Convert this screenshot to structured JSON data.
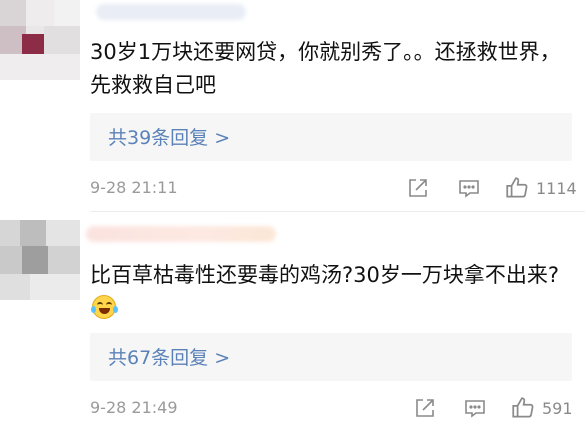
{
  "comments": [
    {
      "text": "30岁1万块还要网贷，你就别秀了。。还拯救世界，先救救自己吧",
      "replies_label": "共39条回复 >",
      "time": "9-28 21:11",
      "likes": "1114"
    },
    {
      "text": "比百草枯毒性还要毒的鸡汤?30岁一万块拿不出来?",
      "replies_label": "共67条回复 >",
      "time": "9-28 21:49",
      "likes": "591"
    }
  ],
  "icons": {
    "share": "share-icon",
    "comment": "comment-icon",
    "like": "thumbs-up-icon",
    "emoji": "laugh-cry-emoji-icon"
  },
  "colors": {
    "link": "#5b82b8",
    "meta": "#9a9a9a",
    "reply_bg": "#f6f6f6"
  }
}
